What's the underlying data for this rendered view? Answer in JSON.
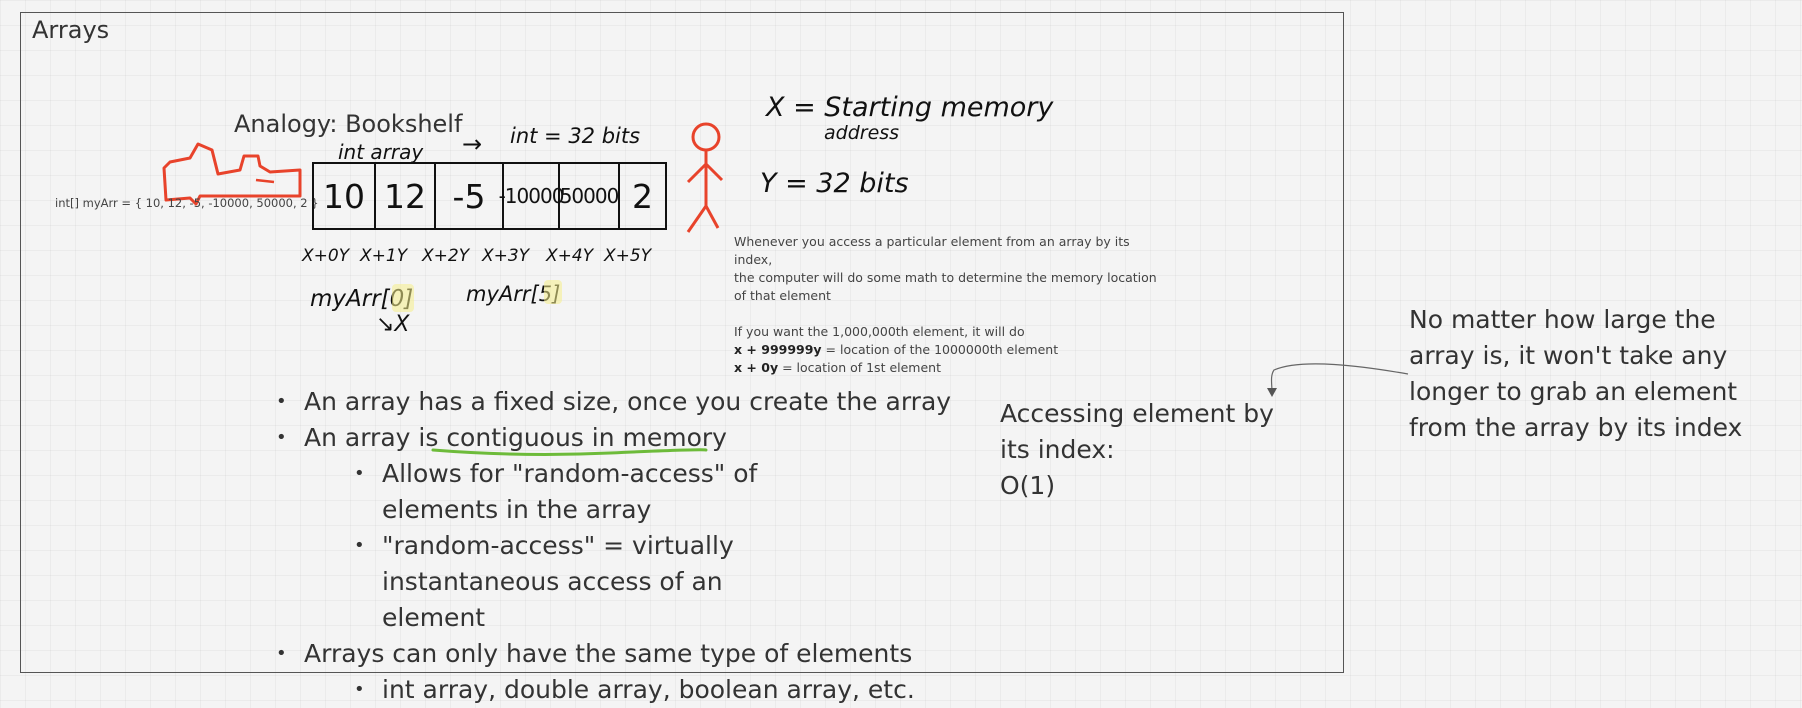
{
  "frame": {
    "title": "Arrays"
  },
  "diagram": {
    "analogy": "Analogy: Bookshelf",
    "declaration": "int[] myArr = { 10, 12, -5, -10000, 50000, 2 }",
    "int_array_label": "int array",
    "arrow": "→",
    "int_bits": "int = 32 bits",
    "cells": [
      "10",
      "12",
      "-5",
      "-10000",
      "50000",
      "2"
    ],
    "offsets": [
      "X+0Y",
      "X+1Y",
      "X+2Y",
      "X+3Y",
      "X+4Y",
      "X+5Y"
    ],
    "access_0": "myArr[0]",
    "access_0_result": "↘X",
    "access_5": "myArr[5]",
    "x_def_1": "X = Starting memory",
    "x_def_2": "address",
    "y_def": "Y = 32 bits",
    "colors": {
      "red": "#e8432b",
      "ink": "#111111",
      "green": "#6dbb3a",
      "highlight": "#f6ef8a"
    }
  },
  "note": {
    "line1": "Whenever you access a particular element from an array by its index,",
    "line2": "the computer will do some math to determine the memory location",
    "line3": "of that element",
    "line4": "If you want the 1,000,000th element, it will do",
    "line5_bold": "x + 999999y",
    "line5_rest": " = location of the 1000000th element",
    "line6_bold": "x + 0y",
    "line6_rest": " = location of 1st element"
  },
  "bullets": {
    "b1": "An array has a fixed size, once you create the array",
    "b2_pre": "An array is ",
    "b2_ul": "contiguous in memory",
    "b2a": "Allows for \"random-access\" of elements in the array",
    "b2b": "\"random-access\" = virtually instantaneous access of an element",
    "b3": "Arrays can only have the same type of elements",
    "b3a": "int array, double array, boolean array, etc."
  },
  "access": {
    "line1": "Accessing element by its index:",
    "line2": "O(1)"
  },
  "side_note": "No matter how large the array is, it won't take any longer to grab an element from the array by its index"
}
